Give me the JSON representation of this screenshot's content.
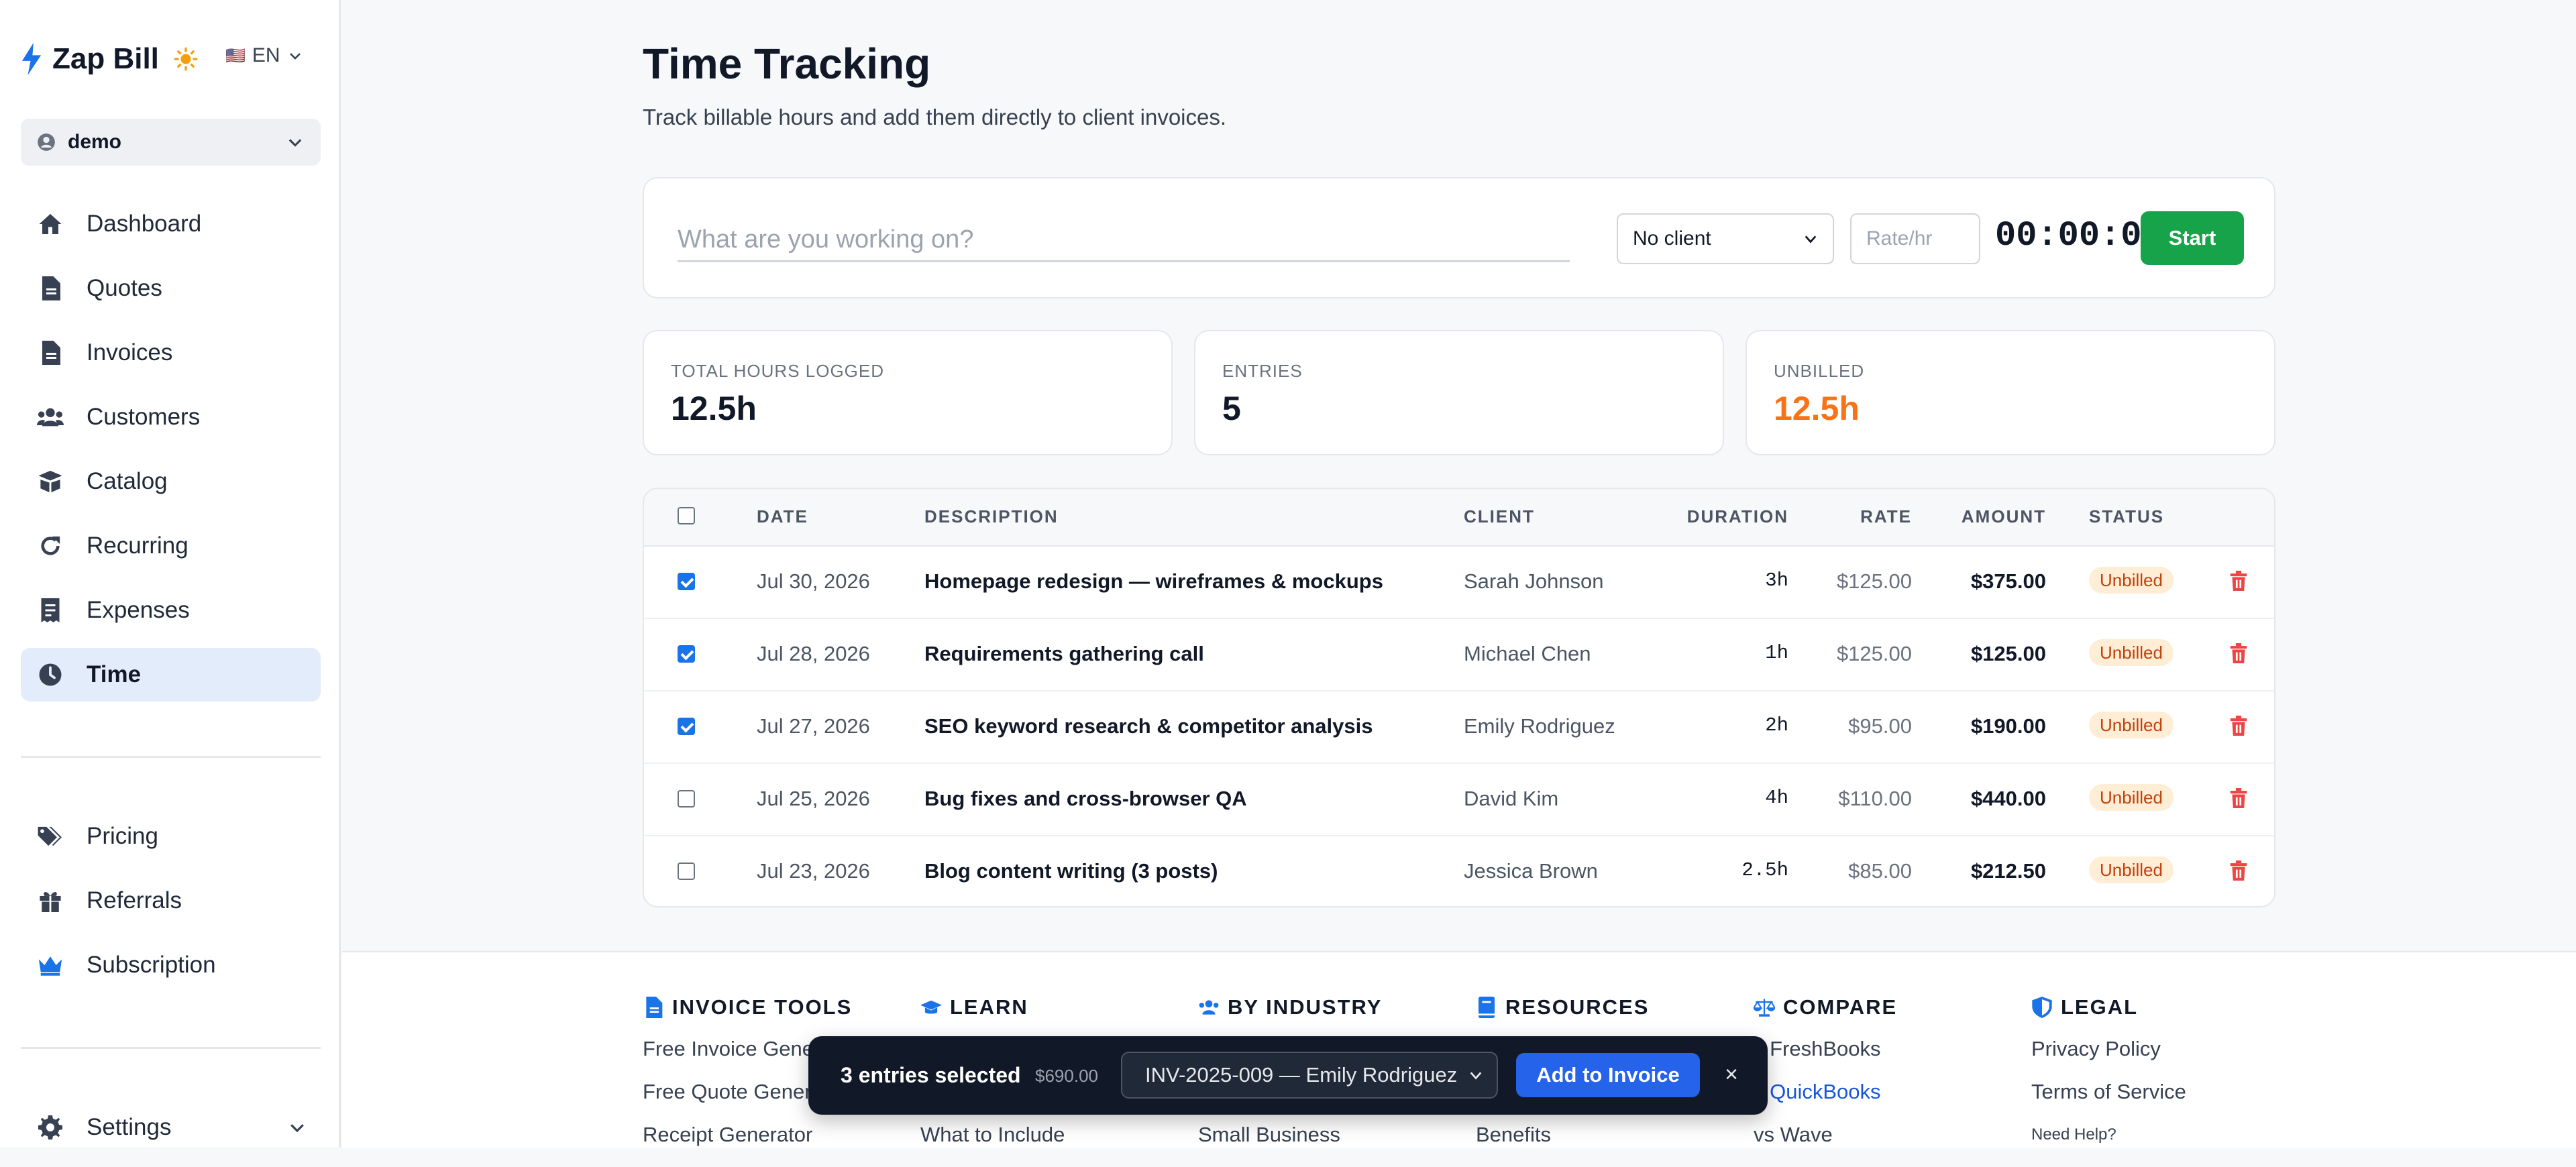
{
  "brand": {
    "name": "Zap Bill",
    "lang": "EN",
    "flag": "🇺🇸"
  },
  "workspace": {
    "name": "demo"
  },
  "nav": {
    "items": [
      {
        "label": "Dashboard",
        "icon": "home-icon"
      },
      {
        "label": "Quotes",
        "icon": "document-icon"
      },
      {
        "label": "Invoices",
        "icon": "document-icon"
      },
      {
        "label": "Customers",
        "icon": "users-icon"
      },
      {
        "label": "Catalog",
        "icon": "box-icon"
      },
      {
        "label": "Recurring",
        "icon": "refresh-icon"
      },
      {
        "label": "Expenses",
        "icon": "receipt-icon"
      },
      {
        "label": "Time",
        "icon": "clock-icon",
        "active": true
      }
    ],
    "secondary": [
      {
        "label": "Pricing",
        "icon": "tags-icon"
      },
      {
        "label": "Referrals",
        "icon": "gift-icon"
      },
      {
        "label": "Subscription",
        "icon": "crown-icon"
      }
    ],
    "settings": {
      "label": "Settings",
      "icon": "gear-icon"
    }
  },
  "page": {
    "title": "Time Tracking",
    "subtitle": "Track billable hours and add them directly to client invoices."
  },
  "timer": {
    "task_placeholder": "What are you working on?",
    "client_value": "No client",
    "rate_placeholder": "Rate/hr",
    "clock": "00:00:00",
    "start_label": "Start"
  },
  "stats": [
    {
      "label": "TOTAL HOURS LOGGED",
      "value": "12.5h"
    },
    {
      "label": "ENTRIES",
      "value": "5"
    },
    {
      "label": "UNBILLED",
      "value": "12.5h"
    }
  ],
  "table": {
    "headers": {
      "date": "DATE",
      "description": "DESCRIPTION",
      "client": "CLIENT",
      "duration": "DURATION",
      "rate": "RATE",
      "amount": "AMOUNT",
      "status": "STATUS"
    },
    "rows": [
      {
        "checked": true,
        "date": "Jul 30, 2026",
        "description": "Homepage redesign — wireframes & mockups",
        "client": "Sarah Johnson",
        "duration": "3h",
        "rate": "$125.00",
        "amount": "$375.00",
        "status": "Unbilled"
      },
      {
        "checked": true,
        "date": "Jul 28, 2026",
        "description": "Requirements gathering call",
        "client": "Michael Chen",
        "duration": "1h",
        "rate": "$125.00",
        "amount": "$125.00",
        "status": "Unbilled"
      },
      {
        "checked": true,
        "date": "Jul 27, 2026",
        "description": "SEO keyword research & competitor analysis",
        "client": "Emily Rodriguez",
        "duration": "2h",
        "rate": "$95.00",
        "amount": "$190.00",
        "status": "Unbilled"
      },
      {
        "checked": false,
        "date": "Jul 25, 2026",
        "description": "Bug fixes and cross-browser QA",
        "client": "David Kim",
        "duration": "4h",
        "rate": "$110.00",
        "amount": "$440.00",
        "status": "Unbilled"
      },
      {
        "checked": false,
        "date": "Jul 23, 2026",
        "description": "Blog content writing (3 posts)",
        "client": "Jessica Brown",
        "duration": "2.5h",
        "rate": "$85.00",
        "amount": "$212.50",
        "status": "Unbilled"
      }
    ]
  },
  "footer": {
    "columns": [
      {
        "title": "INVOICE TOOLS",
        "icon": "document-icon",
        "links": [
          "Free Invoice Gene",
          "Free Quote Gener",
          "Receipt Generator"
        ]
      },
      {
        "title": "LEARN",
        "icon": "graduation-cap-icon",
        "links": [
          "",
          "",
          "What to Include"
        ]
      },
      {
        "title": "BY INDUSTRY",
        "icon": "users-icon",
        "links": [
          "",
          "",
          "Small Business"
        ]
      },
      {
        "title": "RESOURCES",
        "icon": "book-icon",
        "links": [
          "",
          "",
          "Benefits"
        ]
      },
      {
        "title": "COMPARE",
        "icon": "scale-icon",
        "links": [
          "s FreshBooks",
          "s QuickBooks",
          "vs Wave"
        ]
      },
      {
        "title": "LEGAL",
        "icon": "shield-icon",
        "links": [
          "Privacy Policy",
          "Terms of Service",
          "Need Help?"
        ]
      }
    ]
  },
  "selection_bar": {
    "count_label": "3 entries selected",
    "total": "$690.00",
    "invoice_value": "INV-2025-009 — Emily Rodriguez",
    "add_label": "Add to Invoice",
    "close_label": "×"
  },
  "colors": {
    "accent": "#1a73e8",
    "success": "#16a34a",
    "warning": "#f97316",
    "danger": "#ef4444"
  }
}
